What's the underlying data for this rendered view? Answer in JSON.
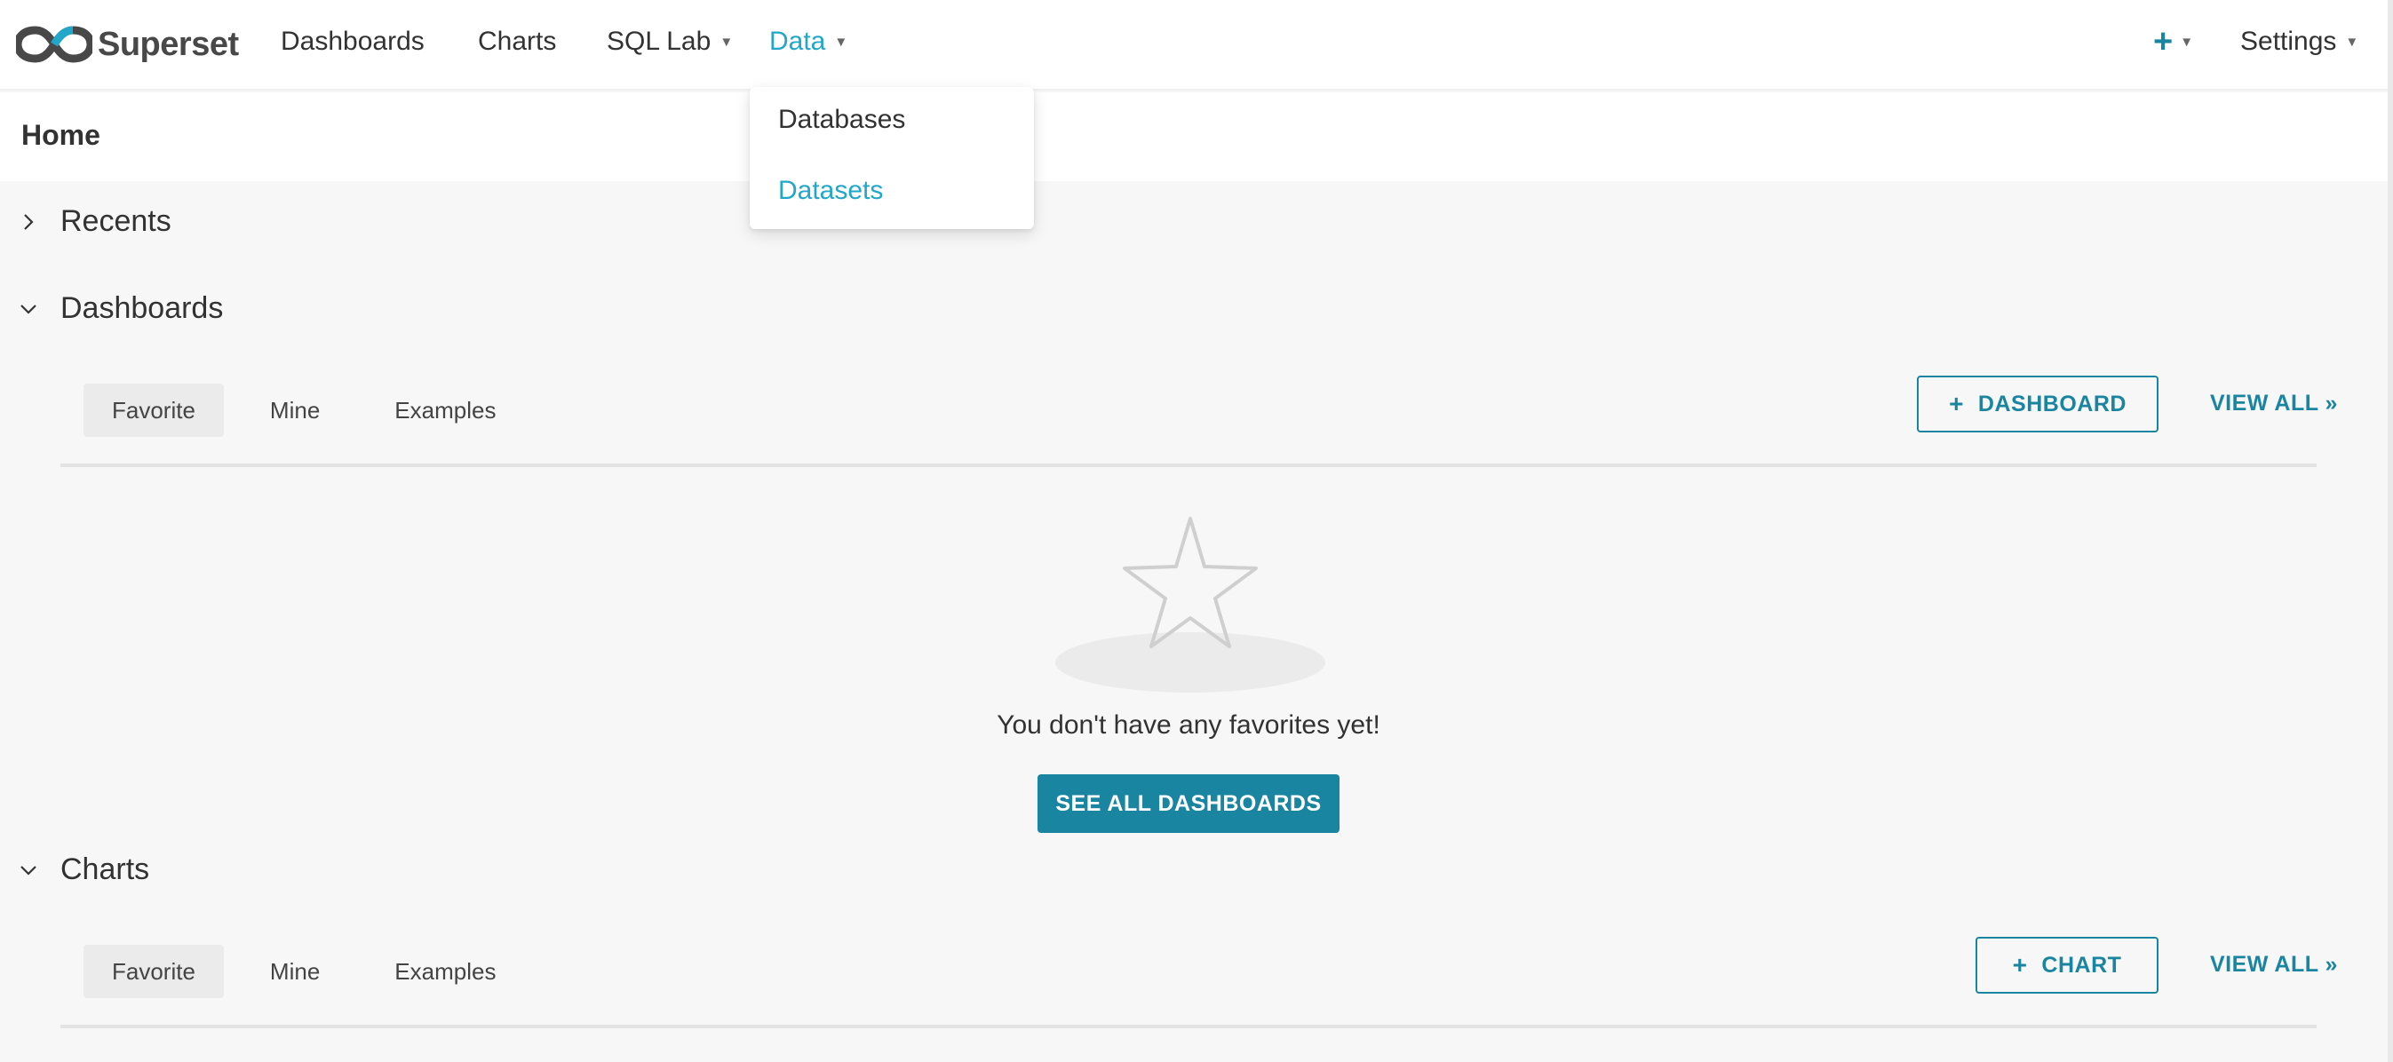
{
  "navbar": {
    "brand": "Superset",
    "items": [
      {
        "label": "Dashboards",
        "dropdown": false
      },
      {
        "label": "Charts",
        "dropdown": false
      },
      {
        "label": "SQL Lab",
        "dropdown": true
      },
      {
        "label": "Data",
        "dropdown": true,
        "active": true
      }
    ],
    "settings_label": "Settings",
    "caret": "▼",
    "plus_icon": "+"
  },
  "data_dropdown": {
    "items": [
      "Databases",
      "Datasets"
    ],
    "highlighted": "Datasets"
  },
  "page": {
    "title": "Home"
  },
  "sections": {
    "recents": {
      "title": "Recents",
      "expanded": false
    },
    "dashboards": {
      "title": "Dashboards",
      "expanded": true,
      "tabs": [
        "Favorite",
        "Mine",
        "Examples"
      ],
      "selected_tab": "Favorite",
      "add_button": "DASHBOARD",
      "view_all": "VIEW ALL »",
      "empty_text": "You don't have any favorites yet!",
      "see_all_button": "SEE ALL DASHBOARDS"
    },
    "charts": {
      "title": "Charts",
      "expanded": true,
      "tabs": [
        "Favorite",
        "Mine",
        "Examples"
      ],
      "selected_tab": "Favorite",
      "add_button": "CHART",
      "view_all": "VIEW ALL »"
    }
  },
  "colors": {
    "primary": "#1a85a0",
    "active_link": "#20a7c9",
    "background": "#f7f7f7"
  },
  "icons": {
    "logo": "superset-infinity-logo",
    "collapsed": "chevron-right-icon",
    "expanded": "chevron-down-icon",
    "empty_state": "star-icon"
  }
}
